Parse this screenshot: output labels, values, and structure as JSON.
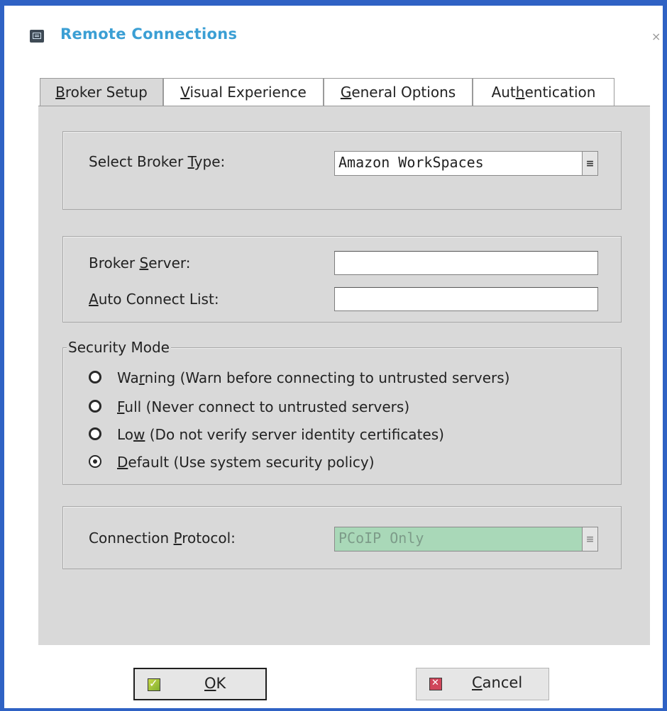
{
  "window": {
    "title": "Remote Connections",
    "close_glyph": "×",
    "accent_color": "#2f62c4",
    "title_color": "#3b9fd4"
  },
  "tabs": [
    {
      "pre": "",
      "key": "B",
      "post": "roker Setup",
      "active": true
    },
    {
      "pre": "",
      "key": "V",
      "post": "isual Experience",
      "active": false
    },
    {
      "pre": "",
      "key": "G",
      "post": "eneral Options",
      "active": false
    },
    {
      "pre": "Aut",
      "key": "h",
      "post": "entication",
      "active": false
    }
  ],
  "broker_type": {
    "label_pre": "Select Broker ",
    "label_key": "T",
    "label_post": "ype:",
    "value": "Amazon WorkSpaces",
    "dropdown_icon": "dropdown-arrow-icon"
  },
  "broker_server": {
    "label_pre": "Broker ",
    "label_key": "S",
    "label_post": "erver:",
    "value": ""
  },
  "auto_connect": {
    "label_pre": "",
    "label_key": "A",
    "label_post": "uto Connect List:",
    "value": ""
  },
  "security": {
    "legend": "Security Mode",
    "options": [
      {
        "pre": "Wa",
        "key": "r",
        "post": "ning (Warn before connecting to untrusted servers)",
        "checked": false
      },
      {
        "pre": "",
        "key": "F",
        "post": "ull (Never connect to untrusted servers)",
        "checked": false
      },
      {
        "pre": "Lo",
        "key": "w",
        "post": " (Do not verify server identity certificates)",
        "checked": false
      },
      {
        "pre": "",
        "key": "D",
        "post": "efault (Use system security policy)",
        "checked": true
      }
    ]
  },
  "protocol": {
    "label_pre": "Connection ",
    "label_key": "P",
    "label_post": "rotocol:",
    "value": "PCoIP Only",
    "disabled": true
  },
  "buttons": {
    "ok": {
      "key": "O",
      "post": "K",
      "icon": "check-icon"
    },
    "cancel": {
      "key": "C",
      "post": "ancel",
      "icon": "cancel-icon"
    }
  }
}
